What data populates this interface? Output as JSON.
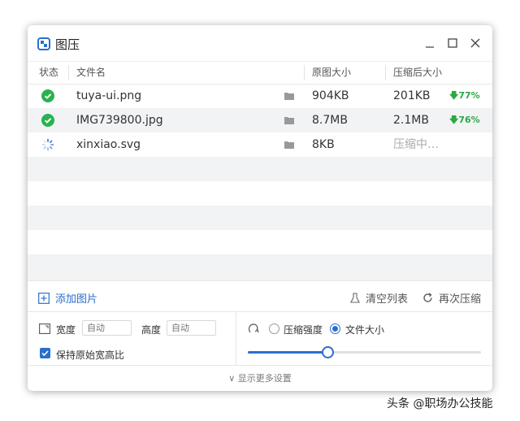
{
  "window": {
    "title": "图压"
  },
  "columns": {
    "status": "状态",
    "filename": "文件名",
    "original_size": "原图大小",
    "compressed_size": "压缩后大小"
  },
  "files": [
    {
      "name": "tuya-ui.png",
      "original": "904KB",
      "compressed": "201KB",
      "ratio": "77%",
      "status": "done"
    },
    {
      "name": "IMG739800.jpg",
      "original": "8.7MB",
      "compressed": "2.1MB",
      "ratio": "76%",
      "status": "done"
    },
    {
      "name": "xinxiao.svg",
      "original": "8KB",
      "compressed": "压缩中…",
      "ratio": "",
      "status": "processing"
    }
  ],
  "actions": {
    "add_images": "添加图片",
    "clear_list": "清空列表",
    "recompress": "再次压缩"
  },
  "settings": {
    "width_label": "宽度",
    "width_placeholder": "自动",
    "height_label": "高度",
    "height_placeholder": "自动",
    "keep_ratio_label": "保持原始宽高比",
    "keep_ratio": true,
    "mode_strength_label": "压缩强度",
    "mode_size_label": "文件大小",
    "selected_mode": "文件大小",
    "slider_value": 0.34
  },
  "more_settings": "显示更多设置",
  "watermark": "头条 @职场办公技能",
  "colors": {
    "accent": "#2a6fce",
    "success": "#27b34f",
    "row_alt": "#f2f3f5"
  }
}
